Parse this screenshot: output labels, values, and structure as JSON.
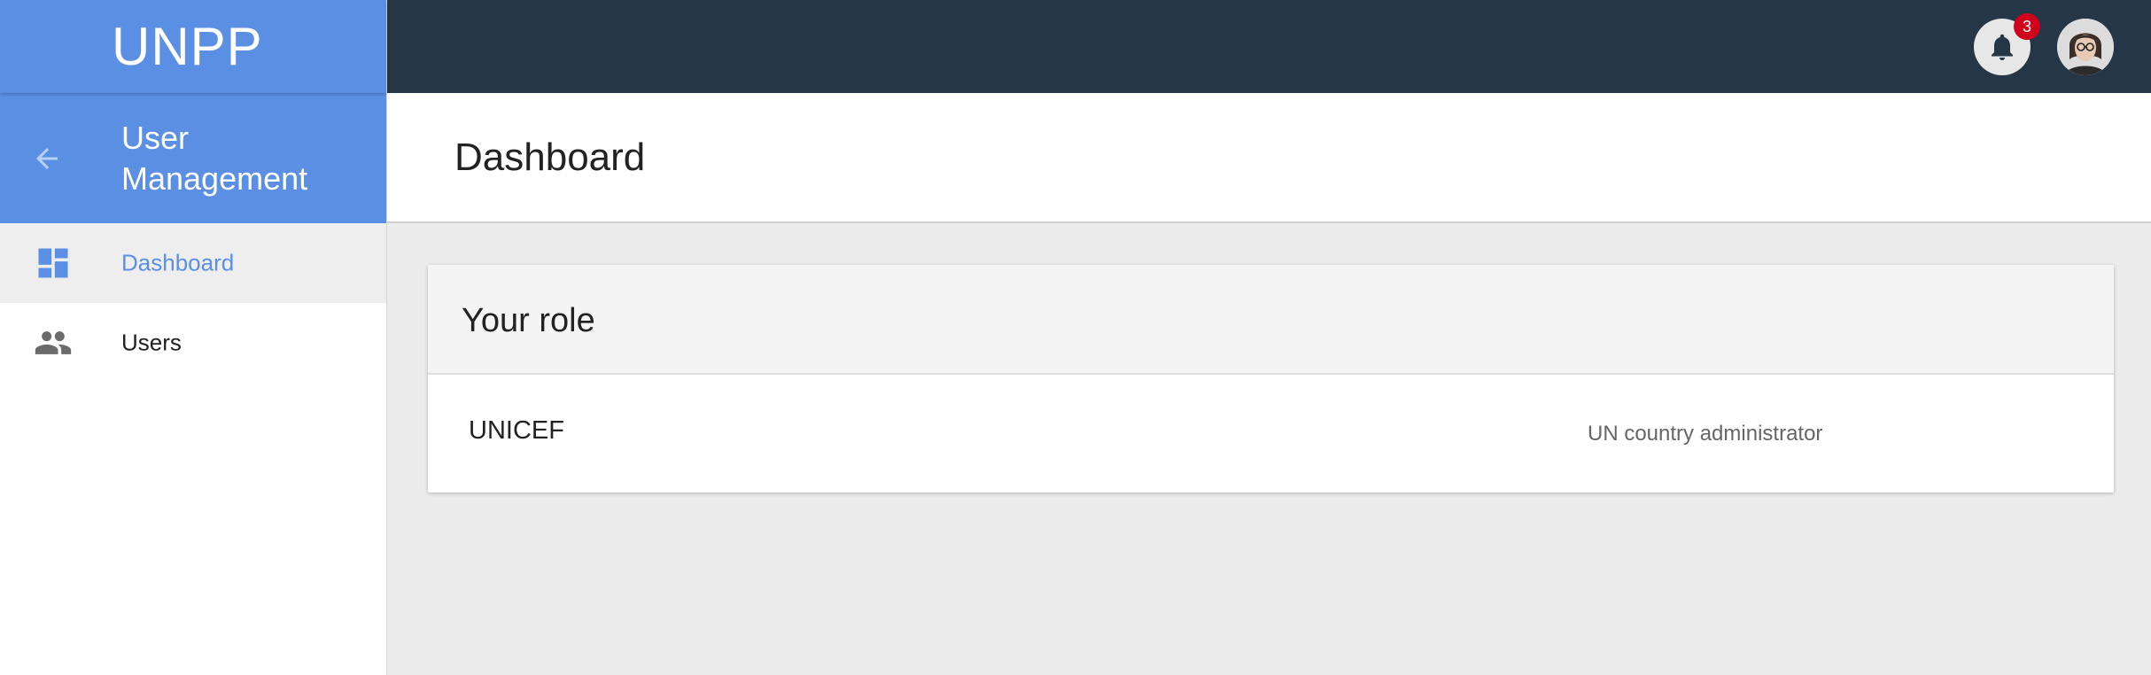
{
  "brand": {
    "name": "UNPP"
  },
  "sidebar": {
    "section_title": "User Management",
    "items": [
      {
        "label": "Dashboard",
        "icon": "dashboard-icon",
        "active": true
      },
      {
        "label": "Users",
        "icon": "users-icon",
        "active": false
      }
    ]
  },
  "topbar": {
    "notifications": {
      "count": "3",
      "icon": "bell-icon"
    },
    "avatar": {
      "icon": "user-avatar"
    }
  },
  "page": {
    "title": "Dashboard"
  },
  "role_card": {
    "title": "Your role",
    "organization": "UNICEF",
    "role": "UN country administrator"
  },
  "colors": {
    "primary": "#5b8fe4",
    "topbar": "#253746",
    "badge": "#d0021b",
    "background": "#ececec"
  }
}
